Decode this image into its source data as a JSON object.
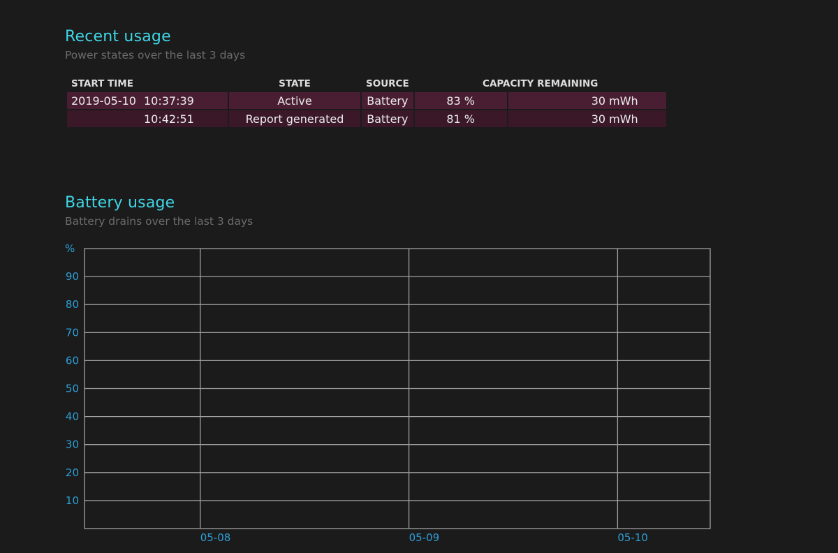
{
  "recent": {
    "title": "Recent usage",
    "subtitle": "Power states over the last 3 days",
    "headers": {
      "start_time": "START TIME",
      "state": "STATE",
      "source": "SOURCE",
      "capacity": "CAPACITY REMAINING"
    },
    "rows": [
      {
        "date": "2019-05-10",
        "time": "10:37:39",
        "state": "Active",
        "source": "Battery",
        "percent": "83 %",
        "capacity": "30 mWh"
      },
      {
        "date": "",
        "time": "10:42:51",
        "state": "Report generated",
        "source": "Battery",
        "percent": "81 %",
        "capacity": "30 mWh"
      }
    ]
  },
  "battery": {
    "title": "Battery usage",
    "subtitle": "Battery drains over the last 3 days"
  },
  "colors": {
    "accent": "#3fd6e6",
    "axis_text": "#2f9fd6",
    "row_1": "#4a1e32",
    "row_2": "#3a1828",
    "grid": "#a0a0a0"
  },
  "chart_data": {
    "type": "line",
    "title": "",
    "ylabel": "%",
    "xlabel": "",
    "ylim": [
      0,
      100
    ],
    "y_ticks": [
      "90",
      "80",
      "70",
      "60",
      "50",
      "40",
      "30",
      "20",
      "10"
    ],
    "y_tick_values": [
      90,
      80,
      70,
      60,
      50,
      40,
      30,
      20,
      10
    ],
    "x_ticks": [
      "05-08",
      "05-09",
      "05-10"
    ],
    "grid": true,
    "legend": "none",
    "series": []
  }
}
